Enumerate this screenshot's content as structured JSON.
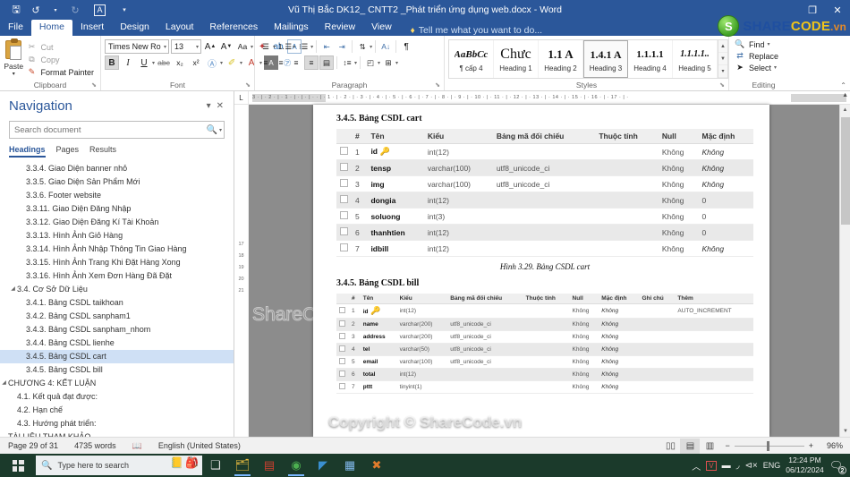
{
  "window": {
    "title": "Vũ Thị Bắc DK12_ CNTT2 _Phát triển ứng dụng web.docx - Word",
    "qat": [
      {
        "name": "save",
        "glyph": "🖫"
      },
      {
        "name": "undo",
        "glyph": "↺"
      },
      {
        "name": "undo-dropdown",
        "glyph": "▾"
      },
      {
        "name": "redo",
        "glyph": "↻"
      },
      {
        "name": "autosave-a",
        "glyph": "A"
      },
      {
        "name": "customize-qat",
        "glyph": "▾"
      }
    ],
    "controls": {
      "restore": "❐",
      "close": "✕"
    }
  },
  "brand": {
    "icon_letter": "S",
    "share": "SHARE",
    "code": "CODE",
    "vn": ".vn"
  },
  "watermarks": {
    "copyright": "Copyright © ShareCode.vn",
    "page": "ShareCode.vn"
  },
  "ribbon": {
    "tabs": [
      {
        "label": "File",
        "active": false
      },
      {
        "label": "Home",
        "active": true
      },
      {
        "label": "Insert",
        "active": false
      },
      {
        "label": "Design",
        "active": false
      },
      {
        "label": "Layout",
        "active": false
      },
      {
        "label": "References",
        "active": false
      },
      {
        "label": "Mailings",
        "active": false
      },
      {
        "label": "Review",
        "active": false
      },
      {
        "label": "View",
        "active": false
      }
    ],
    "tell_me": "Tell me what you want to do...",
    "groups": {
      "clipboard": {
        "title": "Clipboard",
        "paste": "Paste",
        "cut": "Cut",
        "copy": "Copy",
        "format_painter": "Format Painter"
      },
      "font": {
        "title": "Font",
        "font_name": "Times New Ro",
        "font_size": "13",
        "buttons": [
          "Grow Font",
          "Shrink Font",
          "Change Case",
          "Clear Formatting",
          "Bold",
          "Italic",
          "Underline",
          "Strikethrough",
          "Subscript",
          "Superscript",
          "Text Effects",
          "Text Highlight Color",
          "Font Color"
        ]
      },
      "paragraph": {
        "title": "Paragraph",
        "buttons": [
          "Bullets",
          "Numbering",
          "Multilevel List",
          "Decrease Indent",
          "Increase Indent",
          "Sort",
          "Show/Hide",
          "Align Left",
          "Center",
          "Align Right",
          "Justify",
          "Line Spacing",
          "Shading",
          "Borders"
        ]
      },
      "styles": {
        "title": "Styles",
        "items": [
          {
            "preview": "AaBbCc",
            "name": "¶ cấp 4",
            "selected": false
          },
          {
            "preview": "Chưc",
            "name": "Heading 1",
            "selected": false
          },
          {
            "preview": "1.1  A",
            "name": "Heading 2",
            "selected": false
          },
          {
            "preview": "1.4.1  A",
            "name": "Heading 3",
            "selected": true
          },
          {
            "preview": "1.1.1.1",
            "name": "Heading 4",
            "selected": false
          },
          {
            "preview": "1.1.1.1..",
            "name": "Heading 5",
            "selected": false
          }
        ]
      },
      "editing": {
        "title": "Editing",
        "find": "Find",
        "replace": "Replace",
        "select": "Select"
      }
    }
  },
  "navigation": {
    "title": "Navigation",
    "search_placeholder": "Search document",
    "search_value": "",
    "tabs": [
      {
        "label": "Headings",
        "active": true
      },
      {
        "label": "Pages",
        "active": false
      },
      {
        "label": "Results",
        "active": false
      }
    ],
    "items": [
      {
        "label": "3.3.4. Giao Diện banner nhỏ",
        "indent": 2,
        "arrow": "",
        "selected": false
      },
      {
        "label": "3.3.5. Giao Diện Sản Phẩm Mới",
        "indent": 2,
        "arrow": "",
        "selected": false
      },
      {
        "label": "3.3.6. Footer website",
        "indent": 2,
        "arrow": "",
        "selected": false
      },
      {
        "label": "3.3.11. Giao Diện Đăng Nhập",
        "indent": 2,
        "arrow": "",
        "selected": false
      },
      {
        "label": "3.3.12. Giao Diện Đăng Kí Tài Khoản",
        "indent": 2,
        "arrow": "",
        "selected": false
      },
      {
        "label": "3.3.13. Hình Ảnh Giỏ Hàng",
        "indent": 2,
        "arrow": "",
        "selected": false
      },
      {
        "label": "3.3.14. Hình Ảnh Nhập Thông Tin Giao Hàng",
        "indent": 2,
        "arrow": "",
        "selected": false
      },
      {
        "label": "3.3.15. Hình Ảnh Trang Khi Đặt Hàng Xong",
        "indent": 2,
        "arrow": "",
        "selected": false
      },
      {
        "label": "3.3.16. Hình Ảnh Xem Đơn Hàng Đã Đặt",
        "indent": 2,
        "arrow": "",
        "selected": false
      },
      {
        "label": "3.4. Cơ Sở Dữ Liệu",
        "indent": 1,
        "arrow": "◢",
        "selected": false
      },
      {
        "label": "3.4.1. Bảng CSDL taikhoan",
        "indent": 2,
        "arrow": "",
        "selected": false
      },
      {
        "label": "3.4.2. Bảng CSDL sanpham1",
        "indent": 2,
        "arrow": "",
        "selected": false
      },
      {
        "label": "3.4.3. Bảng CSDL sanpham_nhom",
        "indent": 2,
        "arrow": "",
        "selected": false
      },
      {
        "label": "3.4.4. Bảng CSDL lienhe",
        "indent": 2,
        "arrow": "",
        "selected": false
      },
      {
        "label": "3.4.5. Bảng CSDL cart",
        "indent": 2,
        "arrow": "",
        "selected": true
      },
      {
        "label": "3.4.5. Bảng CSDL bill",
        "indent": 2,
        "arrow": "",
        "selected": false
      },
      {
        "label": "CHƯƠNG 4: KẾT LUẬN",
        "indent": 0,
        "arrow": "◢",
        "selected": false
      },
      {
        "label": "4.1. Kết quả đạt được:",
        "indent": 1,
        "arrow": "",
        "selected": false
      },
      {
        "label": "4.2. Hạn chế",
        "indent": 1,
        "arrow": "",
        "selected": false
      },
      {
        "label": "4.3. Hướng phát triển:",
        "indent": 1,
        "arrow": "",
        "selected": false
      },
      {
        "label": "TÀI LIỆU THAM KHẢO",
        "indent": 0,
        "arrow": "",
        "selected": false
      }
    ]
  },
  "document": {
    "ruler_h": "3 · | · 2 · | · 1 · | · | · | · · | · 1 · | · 2 · | · 3 · | · 4 · | · 5 · | · 6 · | · 7 · | · 8 · | · 9 · | · 10 · | · 11 · | · 12 · | · 13 · | · 14 · | · 15 · | · 16 · | · 17 · | ·",
    "ruler_v": [
      "17",
      "18",
      "19",
      "20",
      "21"
    ],
    "tab_selector": "L",
    "section1": {
      "heading": "3.4.5. Bảng CSDL cart",
      "caption": "Hình 3.29. Bảng CSDL cart",
      "columns": [
        "#",
        "Tên",
        "Kiểu",
        "Bảng mã đối chiếu",
        "Thuộc tính",
        "Null",
        "Mặc định"
      ],
      "rows": [
        {
          "n": "1",
          "name": "id",
          "key": true,
          "type": "int(12)",
          "collation": "",
          "attrs": "",
          "null": "Không",
          "default": "Không",
          "default_italic": true
        },
        {
          "n": "2",
          "name": "tensp",
          "key": false,
          "type": "varchar(100)",
          "collation": "utf8_unicode_ci",
          "attrs": "",
          "null": "Không",
          "default": "Không",
          "default_italic": true
        },
        {
          "n": "3",
          "name": "img",
          "key": false,
          "type": "varchar(100)",
          "collation": "utf8_unicode_ci",
          "attrs": "",
          "null": "Không",
          "default": "Không",
          "default_italic": true
        },
        {
          "n": "4",
          "name": "dongia",
          "key": false,
          "type": "int(12)",
          "collation": "",
          "attrs": "",
          "null": "Không",
          "default": "0",
          "default_italic": false
        },
        {
          "n": "5",
          "name": "soluong",
          "key": false,
          "type": "int(3)",
          "collation": "",
          "attrs": "",
          "null": "Không",
          "default": "0",
          "default_italic": false
        },
        {
          "n": "6",
          "name": "thanhtien",
          "key": false,
          "type": "int(12)",
          "collation": "",
          "attrs": "",
          "null": "Không",
          "default": "0",
          "default_italic": false
        },
        {
          "n": "7",
          "name": "idbill",
          "key": false,
          "type": "int(12)",
          "collation": "",
          "attrs": "",
          "null": "Không",
          "default": "Không",
          "default_italic": true
        }
      ]
    },
    "section2": {
      "heading": "3.4.5. Bảng CSDL bill",
      "columns": [
        "#",
        "Tên",
        "Kiểu",
        "Bảng mã đối chiếu",
        "Thuộc tính",
        "Null",
        "Mặc định",
        "Ghi chú",
        "Thêm"
      ],
      "rows": [
        {
          "n": "1",
          "name": "id",
          "key": true,
          "type": "int(12)",
          "collation": "",
          "attrs": "",
          "null": "Không",
          "default": "Không",
          "default_italic": true,
          "note": "",
          "extra": "AUTO_INCREMENT"
        },
        {
          "n": "2",
          "name": "name",
          "key": false,
          "type": "varchar(200)",
          "collation": "utf8_unicode_ci",
          "attrs": "",
          "null": "Không",
          "default": "Không",
          "default_italic": true,
          "note": "",
          "extra": ""
        },
        {
          "n": "3",
          "name": "address",
          "key": false,
          "type": "varchar(200)",
          "collation": "utf8_unicode_ci",
          "attrs": "",
          "null": "Không",
          "default": "Không",
          "default_italic": true,
          "note": "",
          "extra": ""
        },
        {
          "n": "4",
          "name": "tel",
          "key": false,
          "type": "varchar(50)",
          "collation": "utf8_unicode_ci",
          "attrs": "",
          "null": "Không",
          "default": "Không",
          "default_italic": true,
          "note": "",
          "extra": ""
        },
        {
          "n": "5",
          "name": "email",
          "key": false,
          "type": "varchar(100)",
          "collation": "utf8_unicode_ci",
          "attrs": "",
          "null": "Không",
          "default": "Không",
          "default_italic": true,
          "note": "",
          "extra": ""
        },
        {
          "n": "6",
          "name": "total",
          "key": false,
          "type": "int(12)",
          "collation": "",
          "attrs": "",
          "null": "Không",
          "default": "Không",
          "default_italic": true,
          "note": "",
          "extra": ""
        },
        {
          "n": "7",
          "name": "pttt",
          "key": false,
          "type": "tinyint(1)",
          "collation": "",
          "attrs": "",
          "null": "Không",
          "default": "Không",
          "default_italic": true,
          "note": "",
          "extra": ""
        }
      ]
    }
  },
  "status_bar": {
    "page": "Page 29 of 31",
    "words": "4735 words",
    "proofing_icon": "proofing-errors-icon",
    "language": "English (United States)",
    "views": [
      {
        "name": "read-mode",
        "glyph": "▯▯",
        "active": false
      },
      {
        "name": "print-layout",
        "glyph": "▤",
        "active": true
      },
      {
        "name": "web-layout",
        "glyph": "▥",
        "active": false
      }
    ],
    "zoom_out": "−",
    "zoom_in": "+",
    "zoom_level": "96%"
  },
  "taskbar": {
    "start": "start-button",
    "search_placeholder": "Type here to search",
    "apps": [
      {
        "name": "task-view-icon",
        "glyph": "❑"
      },
      {
        "name": "file-explorer-icon",
        "glyph": "🗂"
      },
      {
        "name": "pdf-reader-icon",
        "glyph": "▤"
      },
      {
        "name": "chrome-icon",
        "glyph": "◉"
      },
      {
        "name": "vs-code-icon",
        "glyph": "◤"
      },
      {
        "name": "store-icon",
        "glyph": "▦"
      },
      {
        "name": "xampp-icon",
        "glyph": "✖"
      }
    ],
    "tray": [
      {
        "name": "show-hidden-icons",
        "glyph": "︿"
      },
      {
        "name": "antivirus-icon",
        "glyph": "V"
      },
      {
        "name": "battery-icon",
        "glyph": "▬"
      },
      {
        "name": "wifi-icon",
        "glyph": "⌃"
      },
      {
        "name": "volume-muted-icon",
        "glyph": "🔇"
      }
    ],
    "language": "ENG",
    "time": "12:24 PM",
    "date": "06/12/2024",
    "notification_count": "2"
  }
}
